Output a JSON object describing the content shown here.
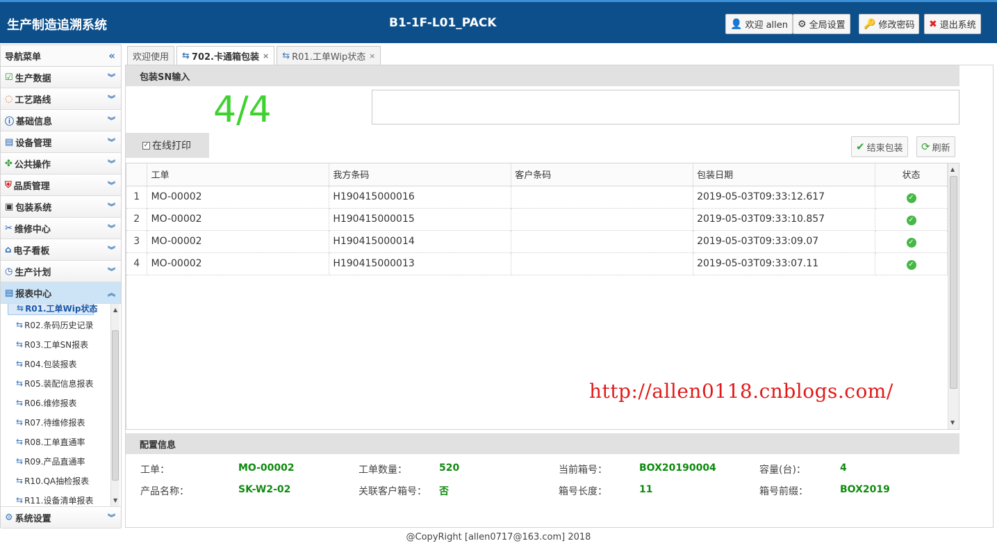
{
  "header": {
    "app_title": "生产制造追溯系统",
    "station": "B1-1F-L01_PACK",
    "buttons": {
      "welcome": "欢迎 allen",
      "global_settings": "全局设置",
      "change_password": "修改密码",
      "logout": "退出系统"
    }
  },
  "sidebar": {
    "title": "导航菜单",
    "collapse_icon": "«",
    "menus": [
      {
        "label": "生产数据",
        "icon": "edit-icon"
      },
      {
        "label": "工艺路线",
        "icon": "route-icon"
      },
      {
        "label": "基础信息",
        "icon": "info-icon"
      },
      {
        "label": "设备管理",
        "icon": "device-icon"
      },
      {
        "label": "公共操作",
        "icon": "clover-icon"
      },
      {
        "label": "品质管理",
        "icon": "shield-icon"
      },
      {
        "label": "包装系统",
        "icon": "save-icon"
      },
      {
        "label": "维修中心",
        "icon": "tools-icon"
      },
      {
        "label": "电子看板",
        "icon": "home-icon"
      },
      {
        "label": "生产计划",
        "icon": "timer-icon"
      },
      {
        "label": "报表中心",
        "icon": "report-icon"
      }
    ],
    "reports": [
      "R01.工单Wip状态",
      "R02.条码历史记录",
      "R03.工单SN报表",
      "R04.包装报表",
      "R05.装配信息报表",
      "R06.维修报表",
      "R07.待维修报表",
      "R08.工单直通率",
      "R09.产品直通率",
      "R10.QA抽检报表",
      "R11.设备清单报表"
    ],
    "bottom_menu": "系统设置"
  },
  "tabs": [
    {
      "label": "欢迎使用",
      "closable": false
    },
    {
      "label": "702.卡通箱包装",
      "closable": true
    },
    {
      "label": "R01.工单Wip状态",
      "closable": true
    }
  ],
  "pack": {
    "panel_title": "包装SN输入",
    "counter": "4/4",
    "sn_value": "",
    "online_print": "在线打印",
    "finish_button": "结束包装",
    "refresh_button": "刷新"
  },
  "grid": {
    "columns": [
      "工单",
      "我方条码",
      "客户条码",
      "包装日期",
      "状态"
    ],
    "rows": [
      {
        "no": "1",
        "order": "MO-00002",
        "sn": "H190415000016",
        "cust": "",
        "date": "2019-05-03T09:33:12.617"
      },
      {
        "no": "2",
        "order": "MO-00002",
        "sn": "H190415000015",
        "cust": "",
        "date": "2019-05-03T09:33:10.857"
      },
      {
        "no": "3",
        "order": "MO-00002",
        "sn": "H190415000014",
        "cust": "",
        "date": "2019-05-03T09:33:09.07"
      },
      {
        "no": "4",
        "order": "MO-00002",
        "sn": "H190415000013",
        "cust": "",
        "date": "2019-05-03T09:33:07.11"
      }
    ]
  },
  "watermark": "http://allen0118.cnblogs.com/",
  "config": {
    "title": "配置信息",
    "order_label": "工单：",
    "order_value": "MO-00002",
    "qty_label": "工单数量：",
    "qty_value": "520",
    "box_label": "当前箱号：",
    "box_value": "BOX20190004",
    "cap_label": "容量(台)：",
    "cap_value": "4",
    "prod_label": "产品名称：",
    "prod_value": "SK-W2-02",
    "link_label": "关联客户箱号：",
    "link_value": "否",
    "len_label": "箱号长度：",
    "len_value": "11",
    "prefix_label": "箱号前缀：",
    "prefix_value": "BOX2019"
  },
  "footer": "@CopyRight [allen0717@163.com] 2018"
}
